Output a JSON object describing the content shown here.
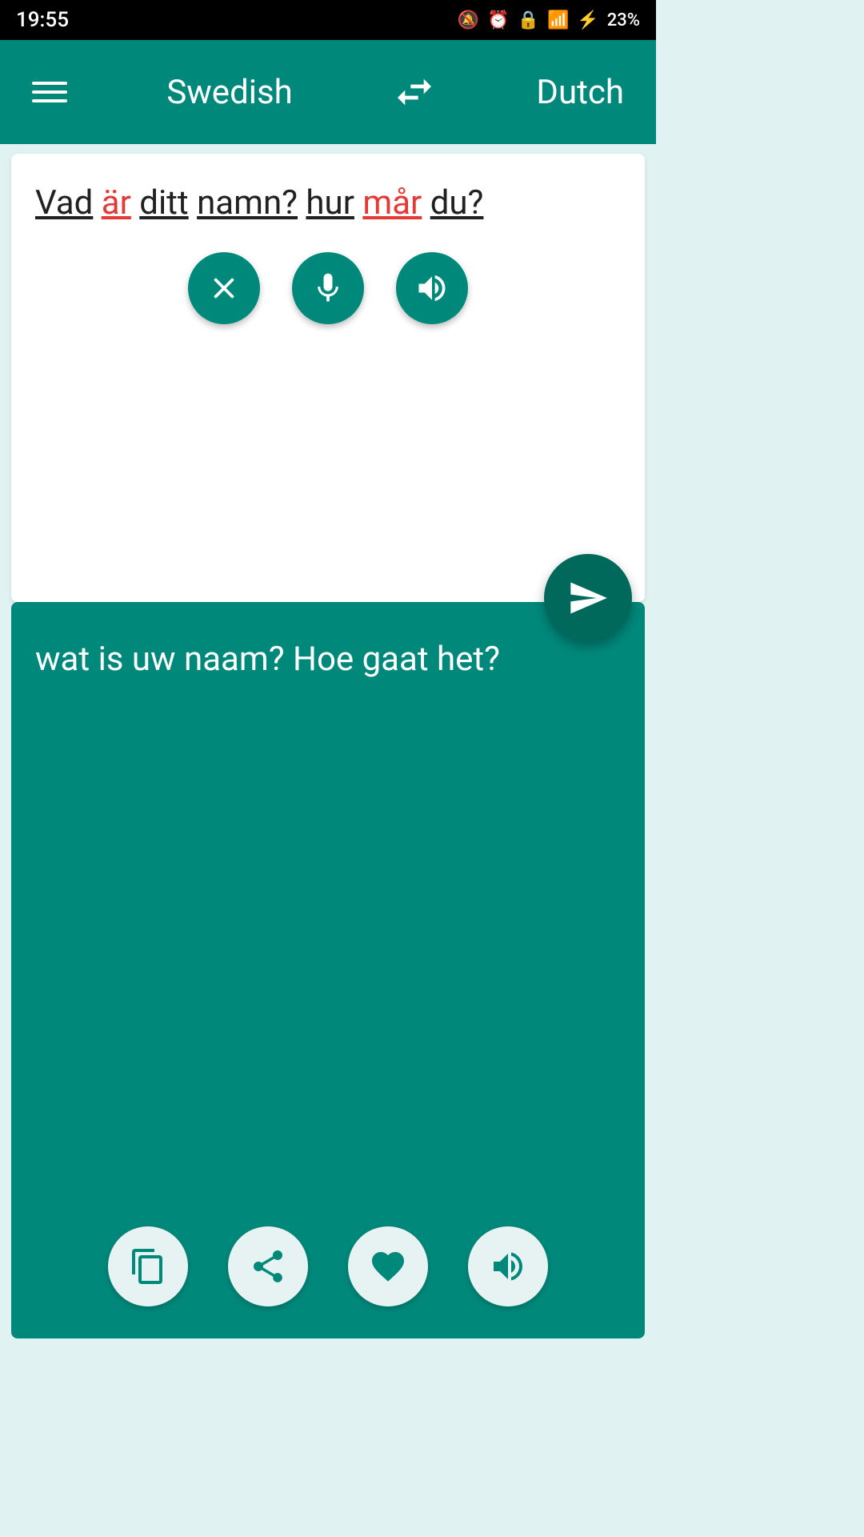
{
  "statusBar": {
    "time": "19:55",
    "battery": "23%"
  },
  "header": {
    "menuLabel": "menu",
    "sourceLang": "Swedish",
    "swapLabel": "swap languages",
    "targetLang": "Dutch"
  },
  "sourceInput": {
    "text": "Vad är ditt namn? hur mår du?",
    "words": [
      {
        "text": "Vad",
        "style": "underline"
      },
      {
        "text": " "
      },
      {
        "text": "är",
        "style": "red-underline"
      },
      {
        "text": " "
      },
      {
        "text": "ditt",
        "style": "underline"
      },
      {
        "text": " "
      },
      {
        "text": "namn?",
        "style": "underline"
      },
      {
        "text": " "
      },
      {
        "text": "hur",
        "style": "underline"
      },
      {
        "text": " "
      },
      {
        "text": "mår",
        "style": "red-underline"
      },
      {
        "text": " "
      },
      {
        "text": "du?",
        "style": "underline"
      }
    ]
  },
  "inputControls": {
    "clearLabel": "clear",
    "micLabel": "microphone",
    "speakLabel": "speak source",
    "sendLabel": "send"
  },
  "translationOutput": {
    "text": "wat is uw naam? Hoe gaat het?"
  },
  "translationControls": {
    "copyLabel": "copy",
    "shareLabel": "share",
    "favoriteLabel": "favorite",
    "speakLabel": "speak translation"
  }
}
